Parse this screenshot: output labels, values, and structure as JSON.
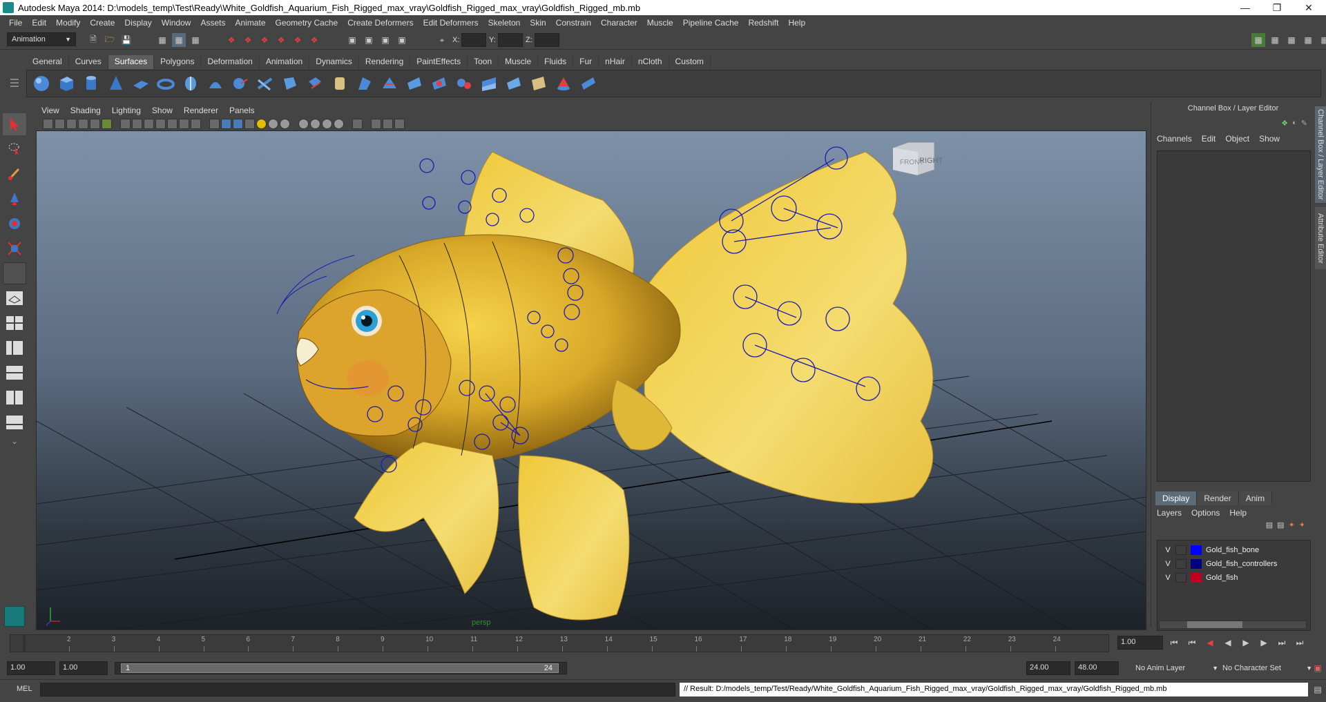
{
  "window": {
    "title": "Autodesk Maya 2014: D:\\models_temp\\Test\\Ready\\White_Goldfish_Aquarium_Fish_Rigged_max_vray\\Goldfish_Rigged_max_vray\\Goldfish_Rigged_mb.mb"
  },
  "menubar": [
    "File",
    "Edit",
    "Modify",
    "Create",
    "Display",
    "Window",
    "Assets",
    "Animate",
    "Geometry Cache",
    "Create Deformers",
    "Edit Deformers",
    "Skeleton",
    "Skin",
    "Constrain",
    "Character",
    "Muscle",
    "Pipeline Cache",
    "Redshift",
    "Help"
  ],
  "statusline": {
    "menuset": "Animation",
    "x_label": "X:",
    "y_label": "Y:",
    "z_label": "Z:"
  },
  "shelf": {
    "tabs": [
      "General",
      "Curves",
      "Surfaces",
      "Polygons",
      "Deformation",
      "Animation",
      "Dynamics",
      "Rendering",
      "PaintEffects",
      "Toon",
      "Muscle",
      "Fluids",
      "Fur",
      "nHair",
      "nCloth",
      "Custom"
    ],
    "active": "Surfaces"
  },
  "panel": {
    "menus": [
      "View",
      "Shading",
      "Lighting",
      "Show",
      "Renderer",
      "Panels"
    ],
    "camera_label": "persp",
    "viewcube": {
      "front": "FRONT",
      "right": "RIGHT"
    }
  },
  "channelbox": {
    "title": "Channel Box / Layer Editor",
    "menus": [
      "Channels",
      "Edit",
      "Object",
      "Show"
    ],
    "tabs": [
      "Display",
      "Render",
      "Anim"
    ],
    "active_tab": "Display",
    "layer_menus": [
      "Layers",
      "Options",
      "Help"
    ],
    "layers": [
      {
        "visible": "V",
        "name": "Gold_fish_bone",
        "color": "#0000ff"
      },
      {
        "visible": "V",
        "name": "Gold_fish_controllers",
        "color": "#000080"
      },
      {
        "visible": "V",
        "name": "Gold_fish",
        "color": "#c00020"
      }
    ]
  },
  "sidetabs": [
    "Channel Box / Layer Editor",
    "Attribute Editor"
  ],
  "timeslider": {
    "ticks": [
      "1",
      "2",
      "3",
      "4",
      "5",
      "6",
      "7",
      "8",
      "9",
      "10",
      "11",
      "12",
      "13",
      "14",
      "15",
      "16",
      "17",
      "18",
      "19",
      "20",
      "21",
      "22",
      "23",
      "24"
    ],
    "current_frame": "1.00"
  },
  "rangeslider": {
    "start": "1.00",
    "playback_start": "1.00",
    "range_start": "1",
    "range_end": "24",
    "playback_end": "24.00",
    "end": "48.00",
    "anim_layer": "No Anim Layer",
    "character_set": "No Character Set"
  },
  "cmdline": {
    "label": "MEL",
    "result": "// Result: D:/models_temp/Test/Ready/White_Goldfish_Aquarium_Fish_Rigged_max_vray/Goldfish_Rigged_max_vray/Goldfish_Rigged_mb.mb"
  }
}
